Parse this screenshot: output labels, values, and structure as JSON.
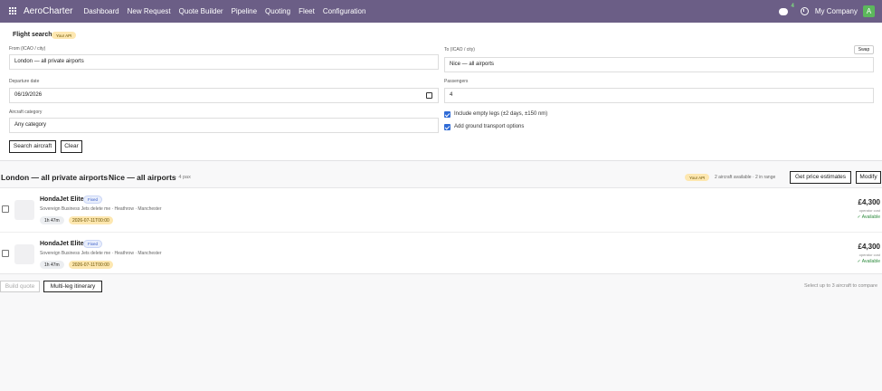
{
  "app": {
    "brand": "AeroCharter",
    "menu": [
      "Dashboard",
      "New Request",
      "Quote Builder",
      "Pipeline",
      "Quoting",
      "Fleet",
      "Configuration"
    ],
    "chat_count": "4",
    "company": "My Company",
    "avatar_letter": "A"
  },
  "search": {
    "title": "Flight search",
    "api_badge": "Your API",
    "from_label": "From (ICAO / city)",
    "from_value": "London — all private airports",
    "to_label": "To (ICAO / city)",
    "to_value": "Nice — all airports",
    "swap_label": "Swap",
    "date_label": "Departure date",
    "date_value": "06/19/2026",
    "pax_label": "Passengers",
    "pax_value": "4",
    "category_label": "Aircraft category",
    "category_value": "Any category",
    "empty_legs_label": "Include empty legs (±2 days, ±150 nm)",
    "ground_label": "Add ground transport options",
    "search_button": "Search aircraft",
    "clear_button": "Clear"
  },
  "results_header": {
    "from": "London — all private airports",
    "to": "Nice — all airports",
    "pax": "· 4 pax",
    "api_badge": "Your API",
    "info": "2 aircraft available · 2 in range",
    "estimate_button": "Get price estimates",
    "modify_button": "Modify"
  },
  "results": [
    {
      "name": "HondaJet Elite",
      "badge": "Fixed",
      "operator": "Sovereign Business Jets delete me · Heathrow · Manchester",
      "duration": "1h 47m",
      "date": "2026-07-11T00:00",
      "price": "£4,300",
      "price_note": "operator cost",
      "availability": "✓ Available"
    },
    {
      "name": "HondaJet Elite",
      "badge": "Fixed",
      "operator": "Sovereign Business Jets delete me · Heathrow · Manchester",
      "duration": "1h 47m",
      "date": "2026-07-11T00:00",
      "price": "£4,300",
      "price_note": "operator cost",
      "availability": "✓ Available"
    }
  ],
  "footer": {
    "build_quote": "Build quote",
    "multi_leg": "Multi-leg itinerary",
    "hint": "Select up to 3 aircraft to compare"
  }
}
